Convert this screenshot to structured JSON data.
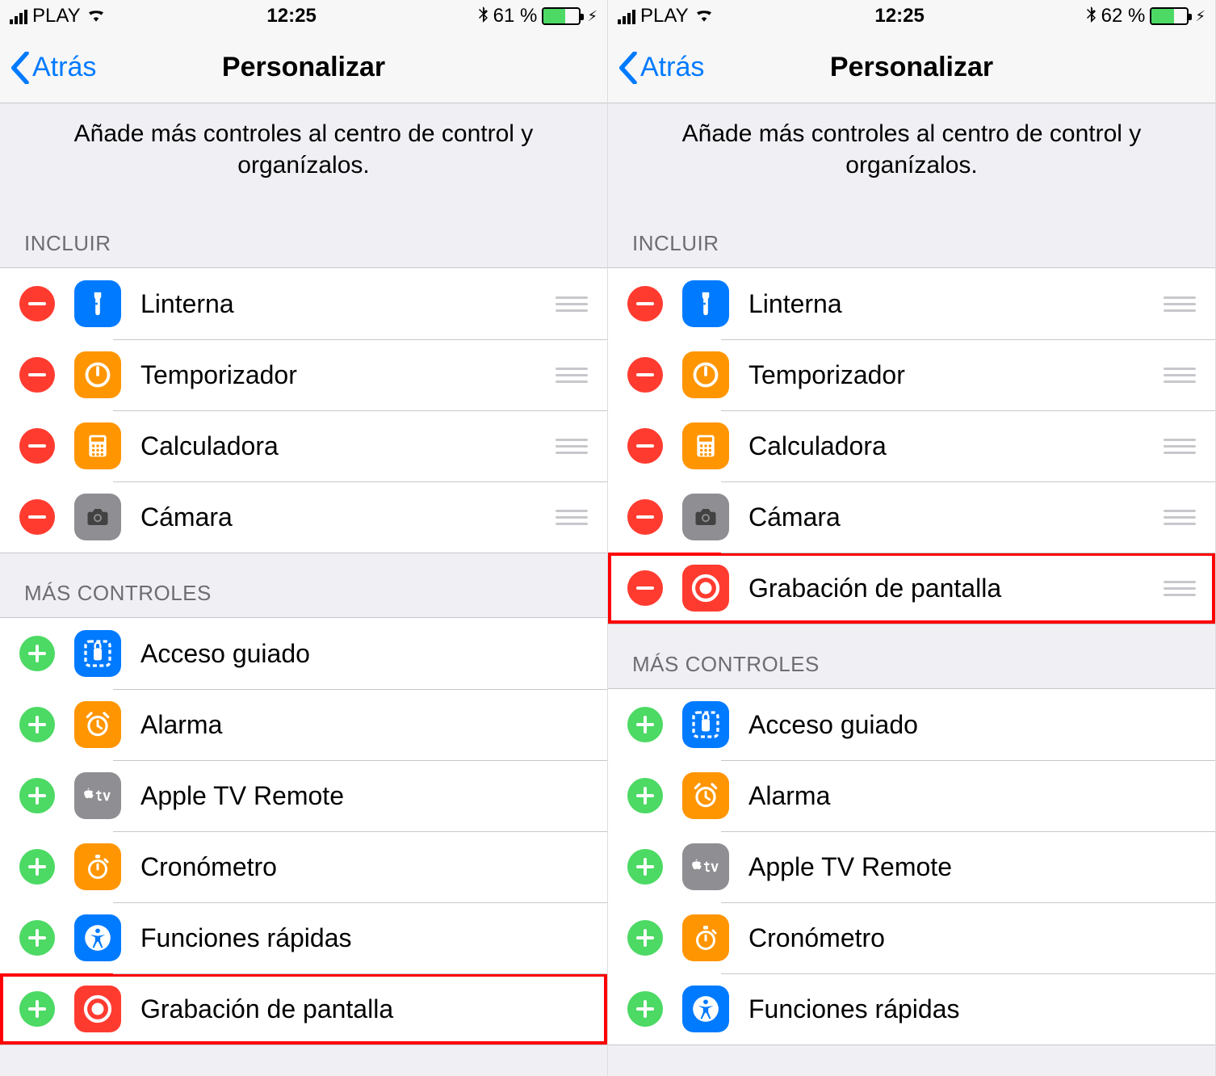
{
  "left": {
    "status": {
      "carrier": "PLAY",
      "time": "12:25",
      "battery_pct": "61 %",
      "battery_fill": "61%"
    },
    "nav": {
      "back": "Atrás",
      "title": "Personalizar"
    },
    "description": "Añade más controles al centro de control y organízalos.",
    "section_include": "INCLUIR",
    "include": [
      {
        "label": "Linterna",
        "icon": "flashlight"
      },
      {
        "label": "Temporizador",
        "icon": "timer"
      },
      {
        "label": "Calculadora",
        "icon": "calc"
      },
      {
        "label": "Cámara",
        "icon": "camera"
      }
    ],
    "section_more": "MÁS CONTROLES",
    "more": [
      {
        "label": "Acceso guiado",
        "icon": "guided"
      },
      {
        "label": "Alarma",
        "icon": "alarm"
      },
      {
        "label": "Apple TV Remote",
        "icon": "appletv"
      },
      {
        "label": "Cronómetro",
        "icon": "stopwatch"
      },
      {
        "label": "Funciones rápidas",
        "icon": "accessibility"
      },
      {
        "label": "Grabación de pantalla",
        "icon": "screenrec",
        "highlighted": true
      }
    ]
  },
  "right": {
    "status": {
      "carrier": "PLAY",
      "time": "12:25",
      "battery_pct": "62 %",
      "battery_fill": "62%"
    },
    "nav": {
      "back": "Atrás",
      "title": "Personalizar"
    },
    "description": "Añade más controles al centro de control y organízalos.",
    "section_include": "INCLUIR",
    "include": [
      {
        "label": "Linterna",
        "icon": "flashlight"
      },
      {
        "label": "Temporizador",
        "icon": "timer"
      },
      {
        "label": "Calculadora",
        "icon": "calc"
      },
      {
        "label": "Cámara",
        "icon": "camera"
      },
      {
        "label": "Grabación de pantalla",
        "icon": "screenrec",
        "highlighted": true
      }
    ],
    "section_more": "MÁS CONTROLES",
    "more": [
      {
        "label": "Acceso guiado",
        "icon": "guided"
      },
      {
        "label": "Alarma",
        "icon": "alarm"
      },
      {
        "label": "Apple TV Remote",
        "icon": "appletv"
      },
      {
        "label": "Cronómetro",
        "icon": "stopwatch"
      },
      {
        "label": "Funciones rápidas",
        "icon": "accessibility"
      }
    ]
  }
}
